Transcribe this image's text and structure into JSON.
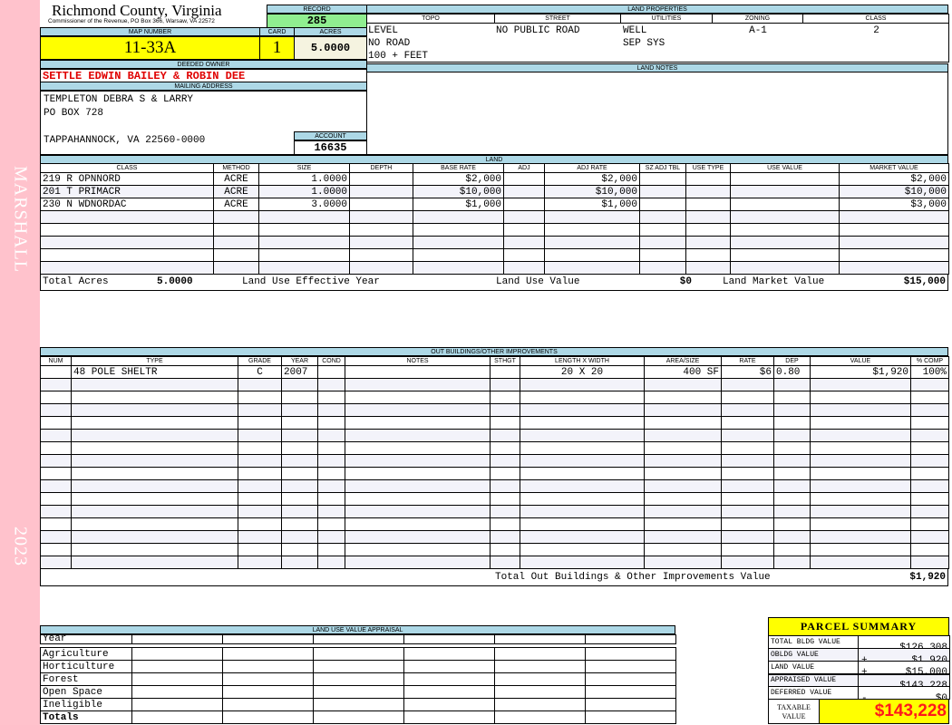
{
  "sidebar": {
    "district": "MARSHALL",
    "year": "2023"
  },
  "header": {
    "title": "Richmond County, Virginia",
    "subtitle": "Commissioner of the Revenue, PO Box 366, Warsaw, VA 22572"
  },
  "record": {
    "label": "RECORD",
    "value": "285"
  },
  "map": {
    "label": "MAP NUMBER",
    "value": "11-33A"
  },
  "card": {
    "label": "CARD",
    "value": "1"
  },
  "acres": {
    "label": "ACRES",
    "value": "5.0000"
  },
  "owner": {
    "label": "DEEDED OWNER",
    "value": "SETTLE EDWIN BAILEY & ROBIN DEE"
  },
  "mailing": {
    "label": "MAILING ADDRESS",
    "lines": [
      "TEMPLETON DEBRA S & LARRY",
      "PO BOX 728",
      "",
      "TAPPAHANNOCK, VA 22560-0000"
    ]
  },
  "account": {
    "label": "ACCOUNT",
    "value": "16635"
  },
  "land_properties": {
    "label": "LAND PROPERTIES",
    "columns": [
      "TOPO",
      "STREET",
      "UTILITIES",
      "ZONING",
      "CLASS"
    ],
    "values": {
      "topo": [
        "LEVEL",
        "NO ROAD",
        "100 + FEET"
      ],
      "street": [
        "NO PUBLIC ROAD"
      ],
      "utilities": [
        "WELL",
        "SEP SYS"
      ],
      "zoning": [
        "A-1"
      ],
      "class": [
        "2"
      ]
    }
  },
  "land_notes": {
    "label": "LAND NOTES"
  },
  "land": {
    "label": "LAND",
    "columns": [
      "CLASS",
      "METHOD",
      "SIZE",
      "DEPTH",
      "BASE RATE",
      "ADJ",
      "ADJ RATE",
      "SZ ADJ TBL",
      "USE TYPE",
      "USE VALUE",
      "MARKET VALUE"
    ],
    "rows": [
      [
        "219 R OPNNORD",
        "ACRE",
        "1.0000",
        "",
        "$2,000",
        "",
        "$2,000",
        "",
        "",
        "",
        "$2,000"
      ],
      [
        "201 T PRIMACR",
        "ACRE",
        "1.0000",
        "",
        "$10,000",
        "",
        "$10,000",
        "",
        "",
        "",
        "$10,000"
      ],
      [
        "230 N WDNORDAC",
        "ACRE",
        "3.0000",
        "",
        "$1,000",
        "",
        "$1,000",
        "",
        "",
        "",
        "$3,000"
      ]
    ],
    "totals": {
      "total_acres_label": "Total Acres",
      "total_acres": "5.0000",
      "effective_year_label": "Land Use Effective Year",
      "effective_year": "",
      "use_value_label": "Land Use Value",
      "use_value": "$0",
      "market_value_label": "Land Market Value",
      "market_value": "$15,000"
    }
  },
  "outbuildings": {
    "label": "OUT BUILDINGS/OTHER IMPROVEMENTS",
    "columns": [
      "NUM",
      "TYPE",
      "GRADE",
      "YEAR",
      "COND",
      "NOTES",
      "STHGT",
      "LENGTH X WIDTH",
      "AREA/SIZE",
      "RATE",
      "DEP",
      "VALUE",
      "% COMP"
    ],
    "rows": [
      [
        "",
        "48 POLE SHELTR",
        "C",
        "2007",
        "",
        "",
        "",
        "20 X 20",
        "400 SF",
        "$6",
        "0.80",
        "$1,920",
        "100%"
      ]
    ],
    "total_label": "Total Out Buildings & Other Improvements Value",
    "total": "$1,920"
  },
  "land_use": {
    "label": "LAND USE VALUE APPRAISAL",
    "year_label": "Year",
    "rows": [
      "Agriculture",
      "Horticulture",
      "Forest",
      "Open Space",
      "Ineligible"
    ],
    "totals_label": "Totals"
  },
  "summary": {
    "title": "PARCEL SUMMARY",
    "rows": [
      {
        "label": "TOTAL BLDG VALUE",
        "op": "",
        "value": "$126,308"
      },
      {
        "label": "OBLDG VALUE",
        "op": "+",
        "value": "$1,920"
      },
      {
        "label": "LAND VALUE",
        "op": "+",
        "value": "$15,000"
      },
      {
        "label": "APPRAISED VALUE",
        "op": "",
        "value": "$143,228"
      },
      {
        "label": "DEFERRED VALUE",
        "op": "-",
        "value": "$0"
      }
    ],
    "taxable_label": "TAXABLE VALUE",
    "taxable": "$143,228"
  },
  "colors": {
    "header_blue": "#add8e6",
    "yellow": "#ffff00",
    "green": "#90ee90",
    "owner_red": "#e00000",
    "sidebar_pink": "#ffc2cc"
  }
}
